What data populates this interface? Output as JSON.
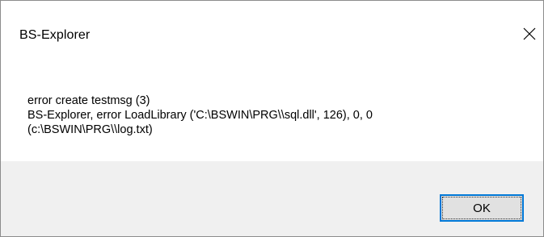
{
  "window": {
    "title": "BS-Explorer",
    "close_icon": "close-icon"
  },
  "message": {
    "line1": "error create testmsg (3)",
    "line2": "BS-Explorer, error LoadLibrary ('C:\\BSWIN\\PRG\\\\sql.dll', 126), 0, 0",
    "line3": "(c:\\BSWIN\\PRG\\\\log.txt)"
  },
  "buttons": {
    "ok_label": "OK"
  },
  "colors": {
    "button_focus_border": "#0078d7",
    "footer_background": "#f0f0f0"
  }
}
